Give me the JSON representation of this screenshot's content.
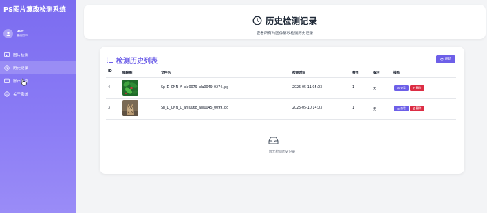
{
  "app": {
    "title": "PS图片篡改检测系统",
    "user": {
      "name": "user",
      "role": "普通用户"
    },
    "nav": [
      {
        "label": "图片检测",
        "icon": "image-icon"
      },
      {
        "label": "历史记录",
        "icon": "history-icon"
      },
      {
        "label": "账户信息",
        "icon": "wallet-icon"
      },
      {
        "label": "关于系统",
        "icon": "info-icon"
      }
    ]
  },
  "header": {
    "title": "历史检测记录",
    "subtitle": "查看所有的图像篡改检测历史记录"
  },
  "list": {
    "title": "检测历史列表",
    "refresh_label": "刷新",
    "columns": [
      "ID",
      "缩略图",
      "文件名",
      "检测时间",
      "费用",
      "备注",
      "操作"
    ],
    "rows": [
      {
        "id": "4",
        "thumb": "green-leaves-thumbnail",
        "filename": "Sp_D_CNN_A_pla0079_pla0049_0274.jpg",
        "time": "2025-05-11 05:03",
        "cost": "1",
        "note": "无",
        "view_label": "查看",
        "delete_label": "删除"
      },
      {
        "id": "3",
        "thumb": "cat-thumbnail",
        "filename": "Sp_D_CNN_C_ani0068_ani0045_0099.jpg",
        "time": "2025-05-10 14:03",
        "cost": "1",
        "note": "无",
        "view_label": "查看",
        "delete_label": "删除"
      }
    ],
    "empty_text": "暂无检测历史记录"
  },
  "colors": {
    "accent": "#6d5fe8",
    "danger": "#dc2d44",
    "sidebar_top": "#7b6cf0",
    "sidebar_bottom": "#9a8cf7"
  }
}
